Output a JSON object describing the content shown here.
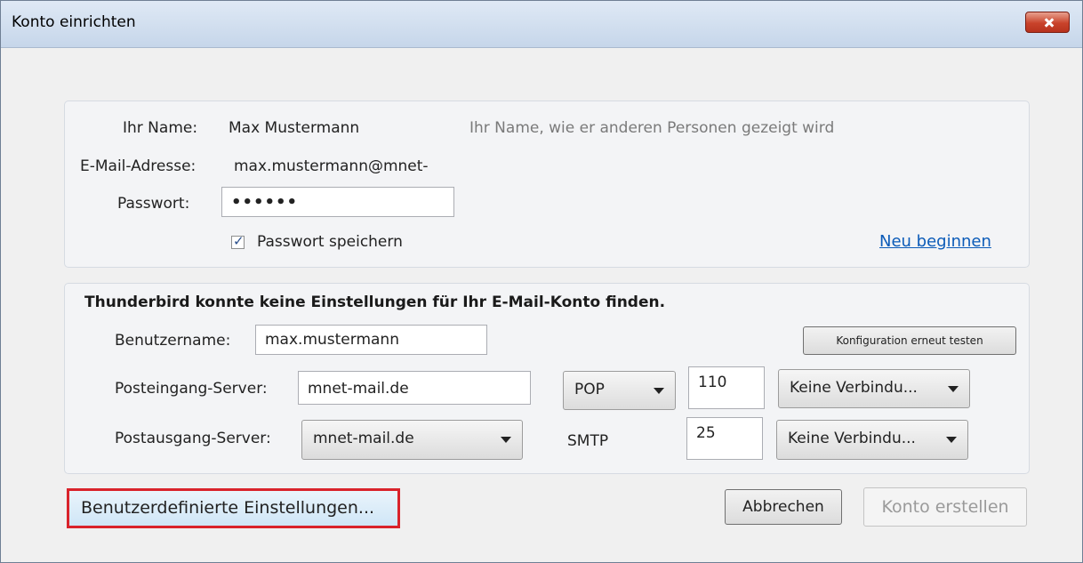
{
  "window": {
    "title": "Konto einrichten",
    "close_icon": "close-icon"
  },
  "account": {
    "name_label": "Ihr Name:",
    "name_value": "Max Mustermann",
    "name_hint": "Ihr Name, wie er anderen Personen gezeigt wird",
    "email_label": "E-Mail-Adresse:",
    "email_value": "max.mustermann@mnet-",
    "password_label": "Passwort:",
    "password_value": "••••••",
    "save_password_label": "Passwort speichern",
    "save_password_checked": true,
    "restart_link": "Neu beginnen"
  },
  "config": {
    "message": "Thunderbird konnte keine Einstellungen für Ihr E-Mail-Konto finden.",
    "username_label": "Benutzername:",
    "username_value": "max.mustermann",
    "retest_button": "Konfiguration erneut testen",
    "incoming_label": "Posteingang-Server:",
    "incoming_server": "mnet-mail.de",
    "incoming_protocol": "POP",
    "incoming_port": "110",
    "incoming_security": "Keine Verbindu...",
    "outgoing_label": "Postausgang-Server:",
    "outgoing_server": "mnet-mail.de",
    "outgoing_protocol": "SMTP",
    "outgoing_port": "25",
    "outgoing_security": "Keine Verbindu..."
  },
  "footer": {
    "custom_button": "Benutzerdefinierte Einstellungen...",
    "cancel_button": "Abbrechen",
    "create_button": "Konto erstellen",
    "highlight_color": "#d9232b"
  }
}
